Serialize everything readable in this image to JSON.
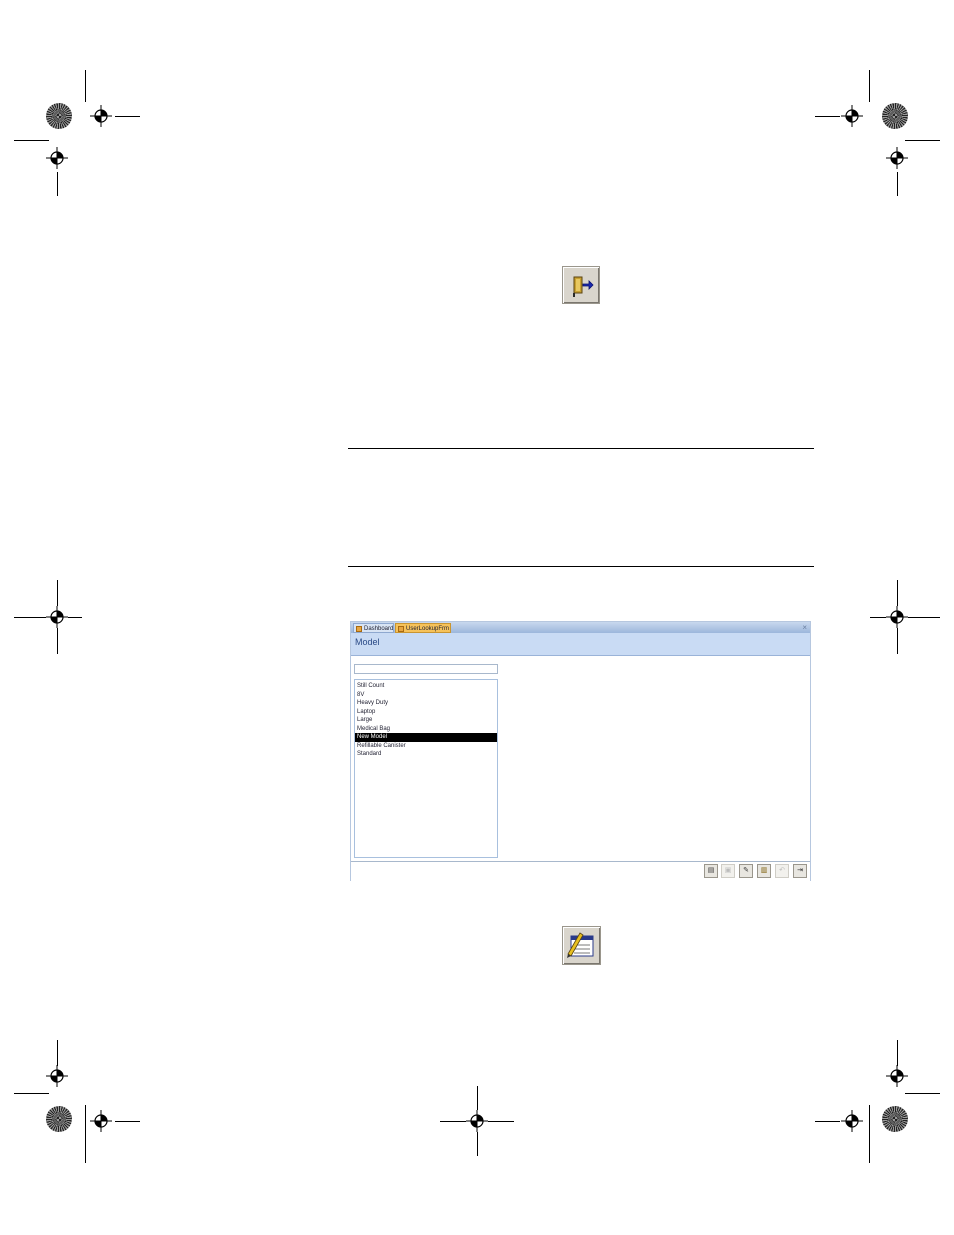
{
  "icons": {
    "exit": "exit-door-icon",
    "edit": "edit-form-icon",
    "registration": "registration-mark-icon"
  },
  "link": {
    "line1": "                                                            ",
    "line2": "            "
  },
  "app": {
    "tabs": [
      {
        "label": "Dashboard"
      },
      {
        "label": "UserLookupFrm"
      }
    ],
    "close_label": "×",
    "header_title": "Model",
    "search_value": "",
    "list_items": [
      "Still Count",
      "8V",
      "Heavy Duty",
      "Laptop",
      "Large",
      "Medical Bag",
      "New Model",
      "Refillable Canister",
      "Standard"
    ],
    "selected_index": 6,
    "toolbar": [
      "new",
      "save",
      "edit",
      "delete",
      "undo",
      "exit"
    ]
  },
  "colors": {
    "link": "#1a1aee",
    "header": "#c9dbf4",
    "active_tab": "#f6c25a",
    "selection": "#000000"
  }
}
